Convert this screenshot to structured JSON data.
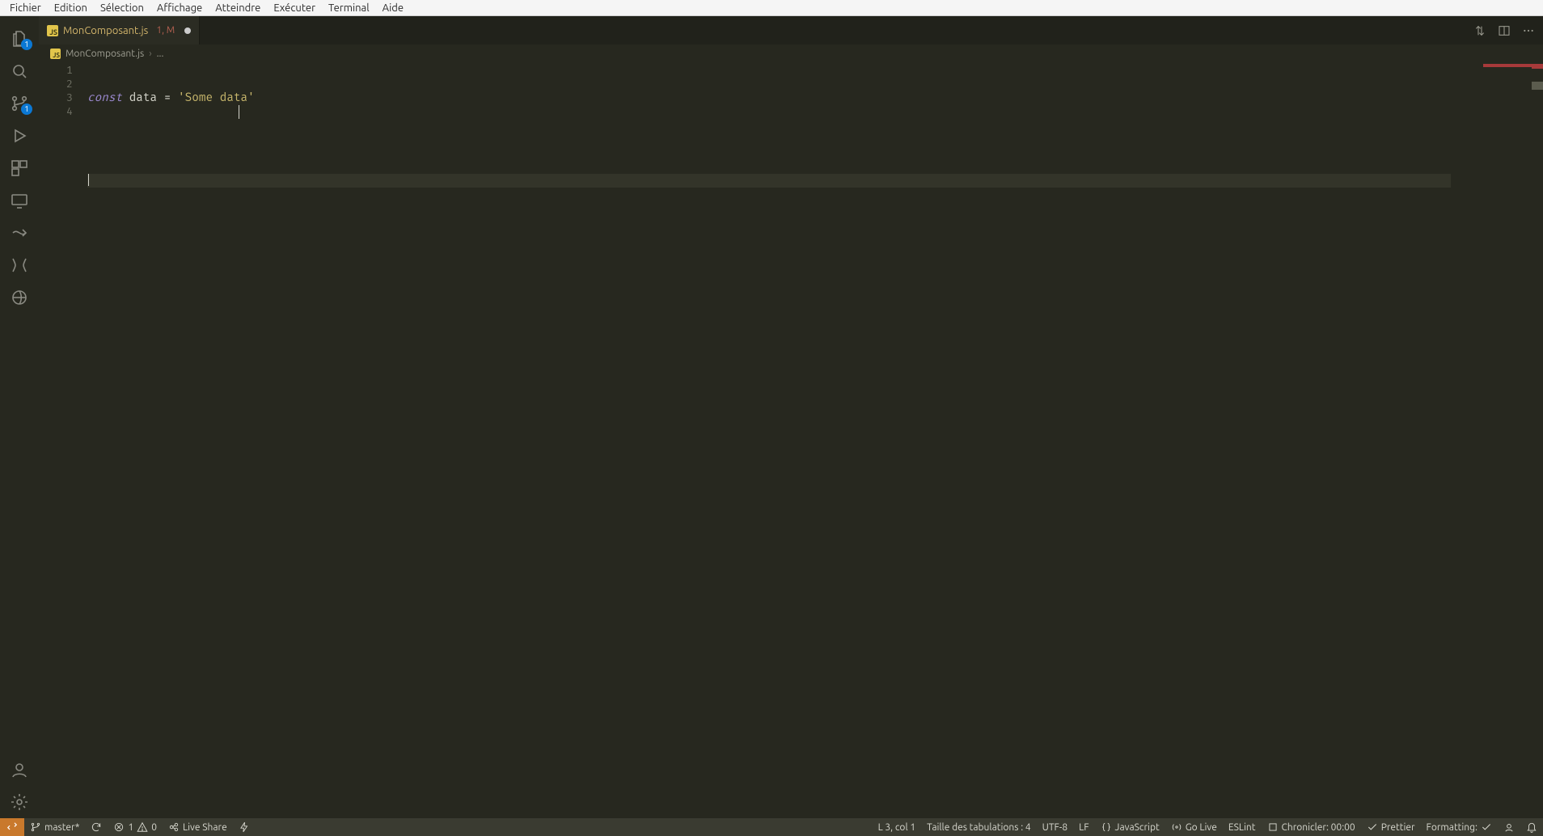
{
  "menu": {
    "items": [
      "Fichier",
      "Edition",
      "Sélection",
      "Affichage",
      "Atteindre",
      "Exécuter",
      "Terminal",
      "Aide"
    ]
  },
  "activityBar": {
    "explorerBadge": "1",
    "scmBadge": "1"
  },
  "tab": {
    "filename": "MonComposant.js",
    "status": "1, M"
  },
  "breadcrumbs": {
    "file": "MonComposant.js",
    "rest": "..."
  },
  "editor": {
    "lineNumbers": [
      "1",
      "2",
      "3",
      "4"
    ],
    "code": {
      "kw": "const",
      "name": " data ",
      "op": "=",
      "str": " 'Some data'"
    }
  },
  "status": {
    "branch": "master*",
    "errors": "1",
    "warnings": "0",
    "liveShare": "Live Share",
    "cursor": "L 3, col 1",
    "indent": "Taille des tabulations : 4",
    "encoding": "UTF-8",
    "eol": "LF",
    "language": "JavaScript",
    "goLive": "Go Live",
    "eslint": "ESLint",
    "chronicler": "Chronicler: 00:00",
    "prettier": "Prettier",
    "formatting": "Formatting:"
  }
}
